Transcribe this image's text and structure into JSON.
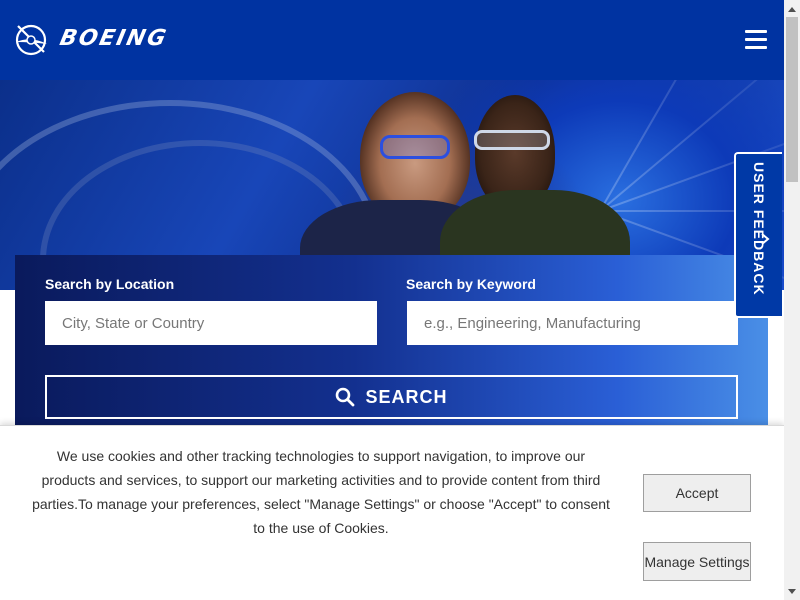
{
  "header": {
    "brand_name": "BOEING",
    "logo_icon": "boeing-logo-icon",
    "menu_icon": "hamburger-menu-icon"
  },
  "search": {
    "location_label": "Search by Location",
    "location_placeholder": "City, State or Country",
    "keyword_label": "Search by Keyword",
    "keyword_placeholder": "e.g., Engineering, Manufacturing",
    "button_label": "SEARCH",
    "button_icon": "search-icon"
  },
  "feedback": {
    "label": "USER FEEDBACK",
    "icon": "chevron-right-icon"
  },
  "cookie": {
    "message": "We use cookies and other tracking technologies to support navigation, to improve our products and services, to support our marketing activities and to provide content from third parties.To manage your preferences, select \"Manage Settings\" or choose \"Accept\" to consent to the use of Cookies.",
    "accept_label": "Accept",
    "manage_label": "Manage Settings"
  },
  "colors": {
    "header_blue": "#0033a1",
    "panel_dark": "#0a1a5c",
    "panel_light": "#4a8fe6",
    "button_gray": "#eeeeee"
  }
}
